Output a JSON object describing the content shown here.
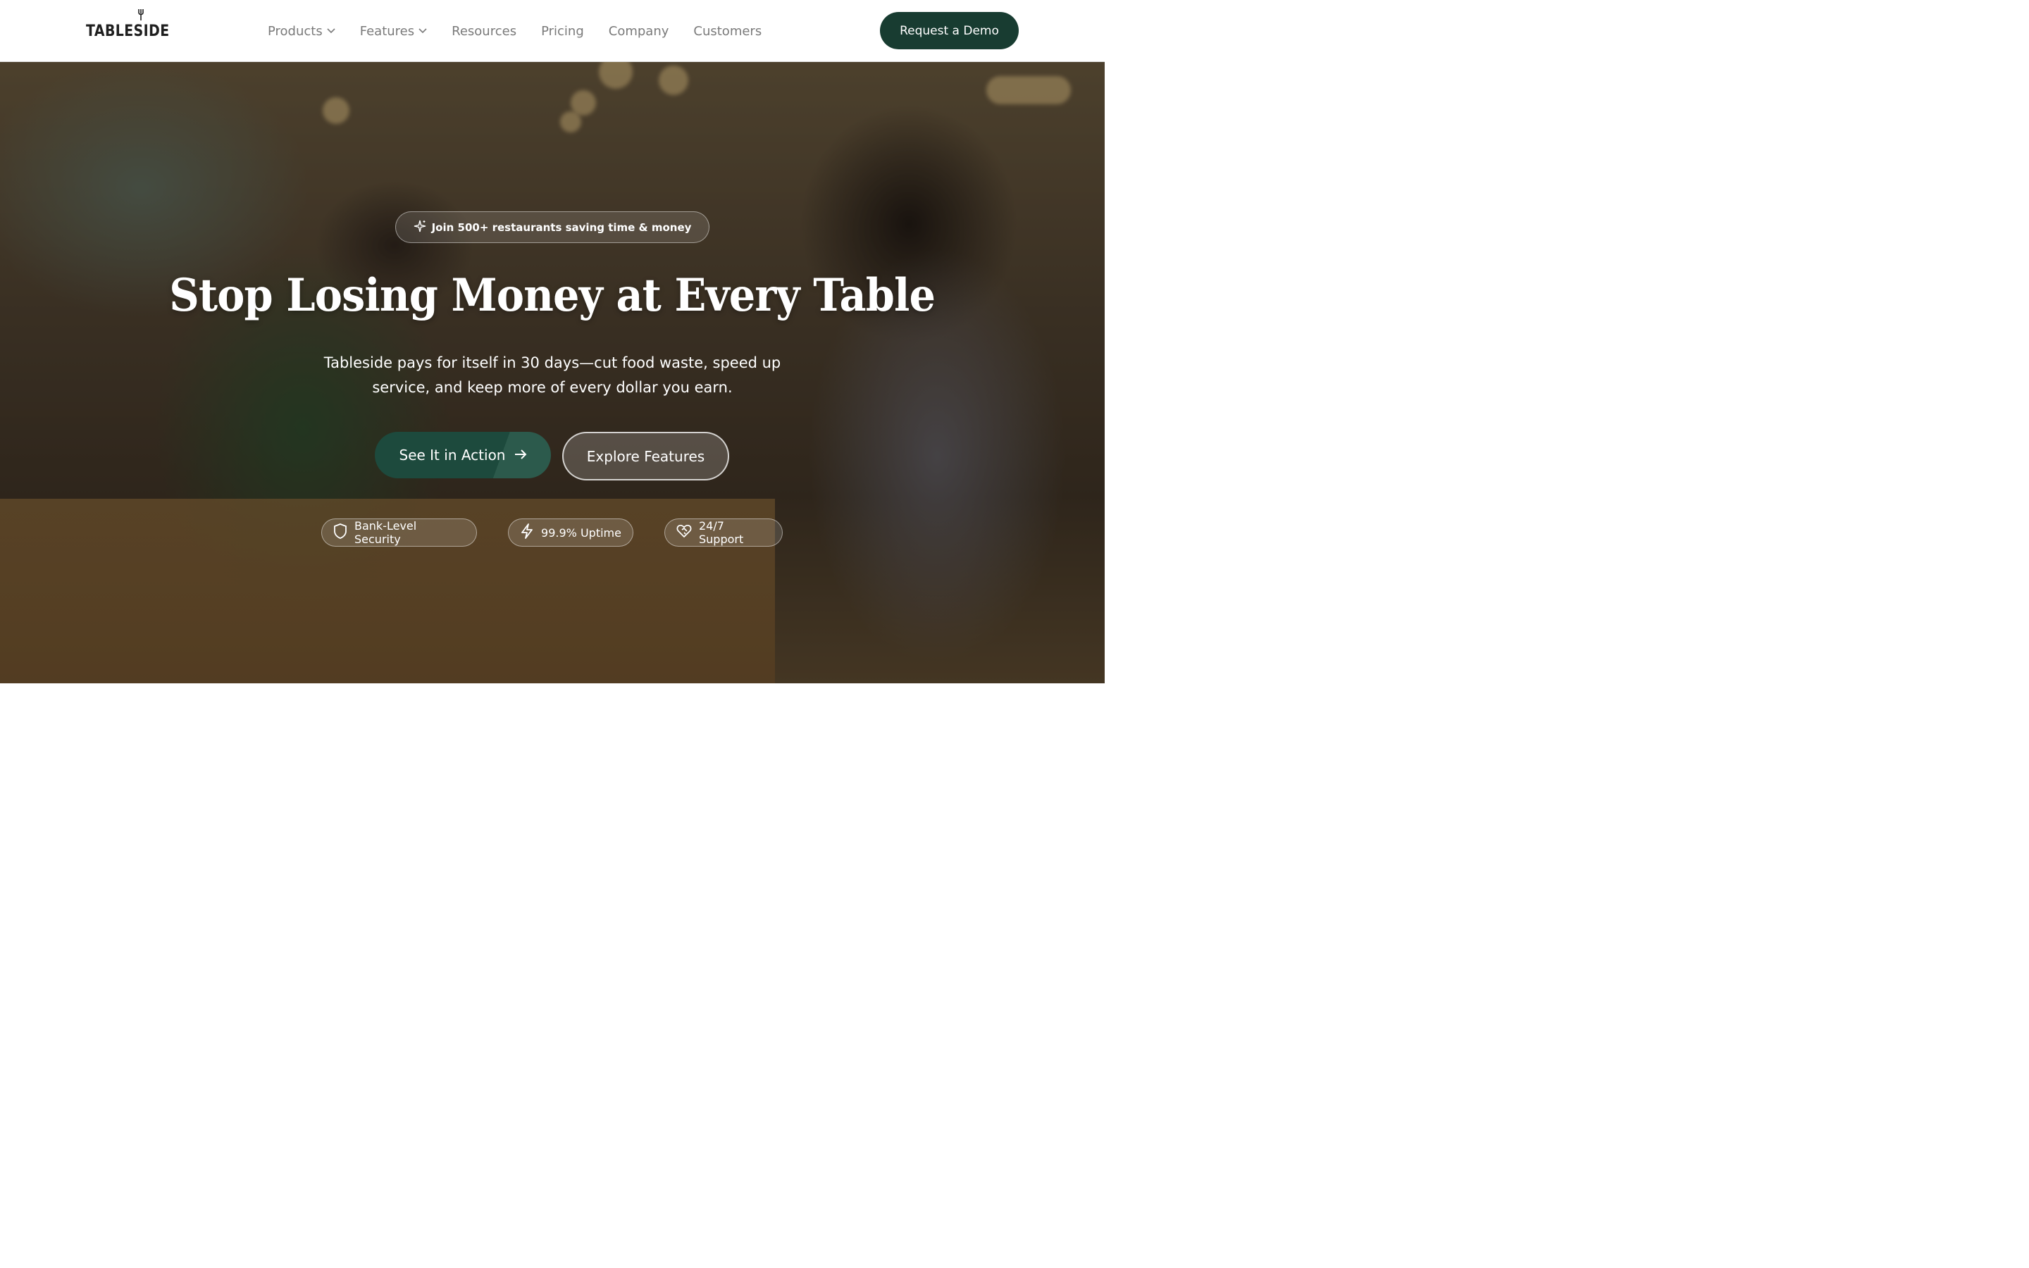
{
  "header": {
    "logo_text": "TABLESIDE",
    "nav": [
      {
        "label": "Products",
        "has_dropdown": true
      },
      {
        "label": "Features",
        "has_dropdown": true
      },
      {
        "label": "Resources",
        "has_dropdown": false
      },
      {
        "label": "Pricing",
        "has_dropdown": false
      },
      {
        "label": "Company",
        "has_dropdown": false
      },
      {
        "label": "Customers",
        "has_dropdown": false
      }
    ],
    "cta_label": "Request a Demo"
  },
  "hero": {
    "eyebrow": "Join 500+ restaurants saving time & money",
    "eyebrow_icon": "sparkles-icon",
    "headline": "Stop Losing Money at Every Table",
    "subtext": "Tableside pays for itself in 30 days—cut food waste, speed up service, and keep more of every dollar you earn.",
    "primary_cta": "See It in Action",
    "primary_cta_icon": "arrow-right-icon",
    "secondary_cta": "Explore Features",
    "badges": [
      {
        "label": "Bank-Level Security",
        "icon": "shield-icon"
      },
      {
        "label": "99.9% Uptime",
        "icon": "lightning-icon"
      },
      {
        "label": "24/7 Support",
        "icon": "heart-handshake-icon"
      }
    ]
  },
  "colors": {
    "brand_dark_green": "#183c31",
    "primary_button": "#1d4a3d",
    "nav_text": "#7a7a7a",
    "logo_text": "#1f1f1f"
  }
}
